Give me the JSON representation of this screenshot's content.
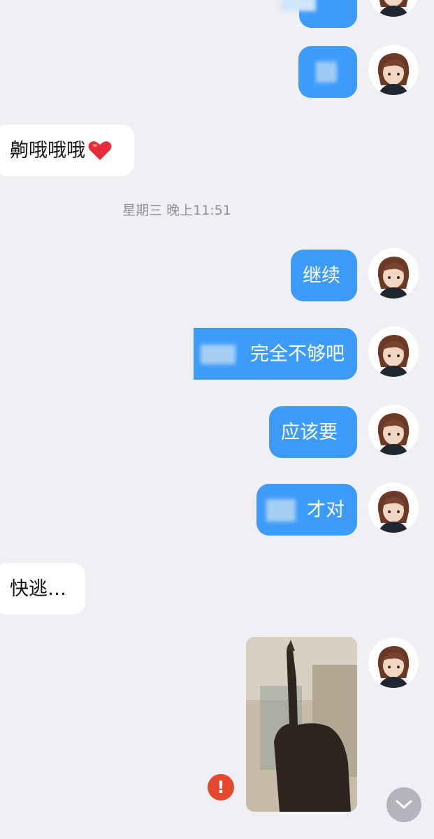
{
  "chat": {
    "timestamp": "星期三 晚上11:51",
    "messages": [
      {
        "side": "in",
        "text": "齁哦哦哦"
      },
      {
        "side": "out",
        "text": "继续"
      },
      {
        "side": "out",
        "text": "完全不够吧"
      },
      {
        "side": "out",
        "text": "应该要"
      },
      {
        "side": "out",
        "text": "才对"
      },
      {
        "side": "in",
        "text": "快逃…"
      }
    ],
    "photo_status": "!"
  },
  "icons": {
    "heart": "heart-icon",
    "error": "error-icon",
    "scroll_down": "chevron-down-icon",
    "avatar": "avatar"
  },
  "colors": {
    "background": "#efeff4",
    "outgoing_bubble": "#3d9bfb",
    "incoming_bubble": "#ffffff",
    "error": "#e5492d",
    "timestamp": "#8f8f94"
  }
}
